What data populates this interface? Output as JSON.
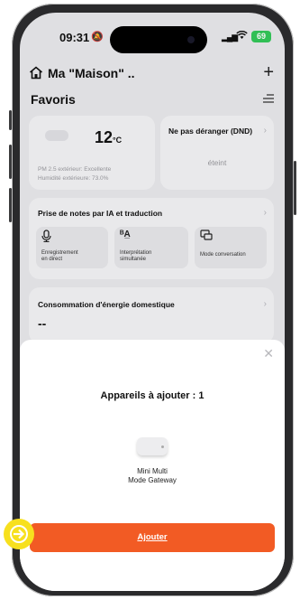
{
  "status_bar": {
    "time": "09:31",
    "silent_icon": "bell-slash-icon",
    "signal_icon": "cellular-signal-icon",
    "wifi_icon": "wifi-icon",
    "battery": "69"
  },
  "header": {
    "home_icon": "house-icon",
    "home_name": "Ma \"Maison\" ..",
    "add_icon": "plus-icon"
  },
  "favorites": {
    "title": "Favoris",
    "menu_icon": "menu-lines-icon"
  },
  "weather_card": {
    "temperature": "12",
    "unit": "°C",
    "pm25": "PM 2.5 extérieur: Excellente",
    "humidity": "Humidité extérieure: 73.0%"
  },
  "dnd_card": {
    "title": "Ne pas déranger (DND)",
    "status": "éteint"
  },
  "ai_card": {
    "title": "Prise de notes par IA et traduction",
    "tiles": [
      {
        "icon": "microphone-icon",
        "label": "Enregistrement\nen direct"
      },
      {
        "icon": "translate-icon",
        "label": "Interprétation\nsimultanée"
      },
      {
        "icon": "conversation-icon",
        "label": "Mode conversation"
      }
    ]
  },
  "energy_card": {
    "title": "Consommation d'énergie domestique",
    "value": "--"
  },
  "sheet": {
    "title": "Appareils à ajouter : 1",
    "device_name_line1": "Mini Multi",
    "device_name_line2": "Mode Gateway",
    "add_button": "Ajouter"
  },
  "colors": {
    "accent": "#f25b24",
    "highlight": "#f7e01e",
    "battery": "#33c759"
  }
}
